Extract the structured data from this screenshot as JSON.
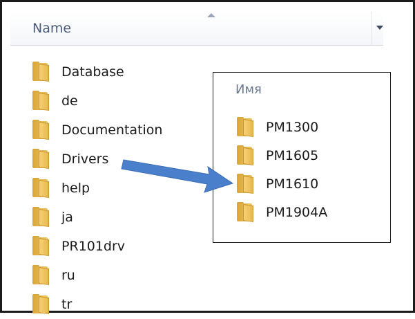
{
  "left_panel": {
    "column_header": "Name",
    "folders": [
      {
        "name": "Database"
      },
      {
        "name": "de"
      },
      {
        "name": "Documentation"
      },
      {
        "name": "Drivers"
      },
      {
        "name": "help"
      },
      {
        "name": "ja"
      },
      {
        "name": "PR101drv"
      },
      {
        "name": "ru"
      },
      {
        "name": "tr"
      }
    ]
  },
  "inset_panel": {
    "column_header": "Имя",
    "folders": [
      {
        "name": "PM1300"
      },
      {
        "name": "PM1605"
      },
      {
        "name": "PM1610"
      },
      {
        "name": "PM1904A"
      }
    ]
  },
  "icons": {
    "folder": "folder-icon",
    "sort": "sort-ascending-icon",
    "dropdown": "chevron-down-icon",
    "callout": "arrow-right-icon"
  },
  "colors": {
    "arrow": "#4a7fcb",
    "folder": "#e8b848",
    "header_text": "#4a5d78"
  }
}
